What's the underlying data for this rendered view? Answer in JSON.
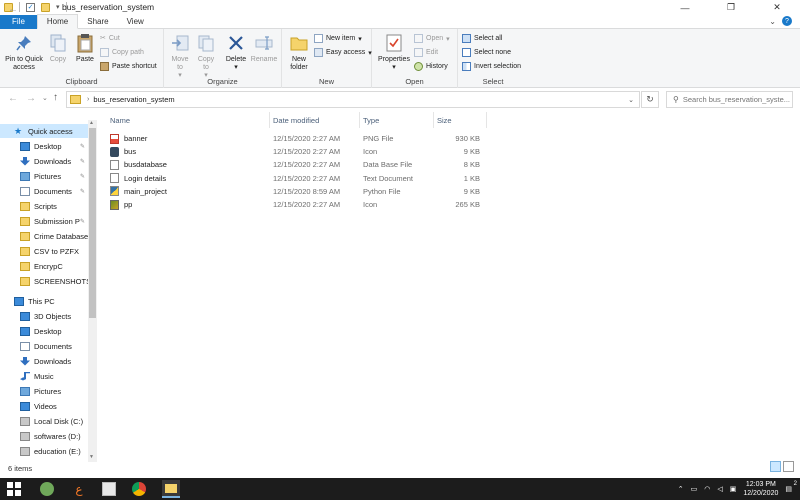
{
  "window": {
    "title": "bus_reservation_system",
    "minimize": "—",
    "maximize": "❐",
    "close": "✕"
  },
  "tabs": [
    {
      "label": "File"
    },
    {
      "label": "Home"
    },
    {
      "label": "Share"
    },
    {
      "label": "View"
    }
  ],
  "ribbon": {
    "clipboard": {
      "label": "Clipboard",
      "pin_to_quick_access": "Pin to Quick access",
      "copy": "Copy",
      "paste": "Paste",
      "cut": "Cut",
      "copy_path": "Copy path",
      "paste_shortcut": "Paste shortcut"
    },
    "organize": {
      "label": "Organize",
      "move_to": "Move to",
      "copy_to": "Copy to",
      "delete": "Delete",
      "rename": "Rename"
    },
    "new": {
      "label": "New",
      "new_folder": "New folder",
      "new_item": "New item",
      "easy_access": "Easy access"
    },
    "open": {
      "label": "Open",
      "properties": "Properties",
      "open": "Open",
      "edit": "Edit",
      "history": "History"
    },
    "select": {
      "label": "Select",
      "select_all": "Select all",
      "select_none": "Select none",
      "invert_selection": "Invert selection"
    }
  },
  "address": {
    "path": "bus_reservation_system",
    "search_placeholder": "Search bus_reservation_syste..."
  },
  "sidebar": {
    "quick_access": "Quick access",
    "quick_items": [
      "Desktop",
      "Downloads",
      "Pictures",
      "Documents",
      "Scripts",
      "Submission P",
      "Crime Database",
      "CSV to PZFX",
      "EncrypC",
      "SCREENSHOTS"
    ],
    "this_pc": "This PC",
    "pc_items": [
      "3D Objects",
      "Desktop",
      "Documents",
      "Downloads",
      "Music",
      "Pictures",
      "Videos",
      "Local Disk (C:)",
      "softwares (D:)",
      "education (E:)"
    ]
  },
  "columns": {
    "name": "Name",
    "date": "Date modified",
    "type": "Type",
    "size": "Size"
  },
  "files": [
    {
      "name": "banner",
      "date": "12/15/2020 2:27 AM",
      "type": "PNG File",
      "size": "930 KB"
    },
    {
      "name": "bus",
      "date": "12/15/2020 2:27 AM",
      "type": "Icon",
      "size": "9 KB"
    },
    {
      "name": "busdatabase",
      "date": "12/15/2020 2:27 AM",
      "type": "Data Base File",
      "size": "8 KB"
    },
    {
      "name": "Login details",
      "date": "12/15/2020 2:27 AM",
      "type": "Text Document",
      "size": "1 KB"
    },
    {
      "name": "main_project",
      "date": "12/15/2020 8:59 AM",
      "type": "Python File",
      "size": "9 KB"
    },
    {
      "name": "pp",
      "date": "12/15/2020 2:27 AM",
      "type": "Icon",
      "size": "265 KB"
    }
  ],
  "status": {
    "item_count": "6 items"
  },
  "taskbar": {
    "time": "12:03 PM",
    "date": "12/20/2020",
    "notification_count": "2"
  },
  "colors": {
    "accent": "#1979ca",
    "selection": "#cce8ff",
    "folder": "#f5d36b"
  }
}
